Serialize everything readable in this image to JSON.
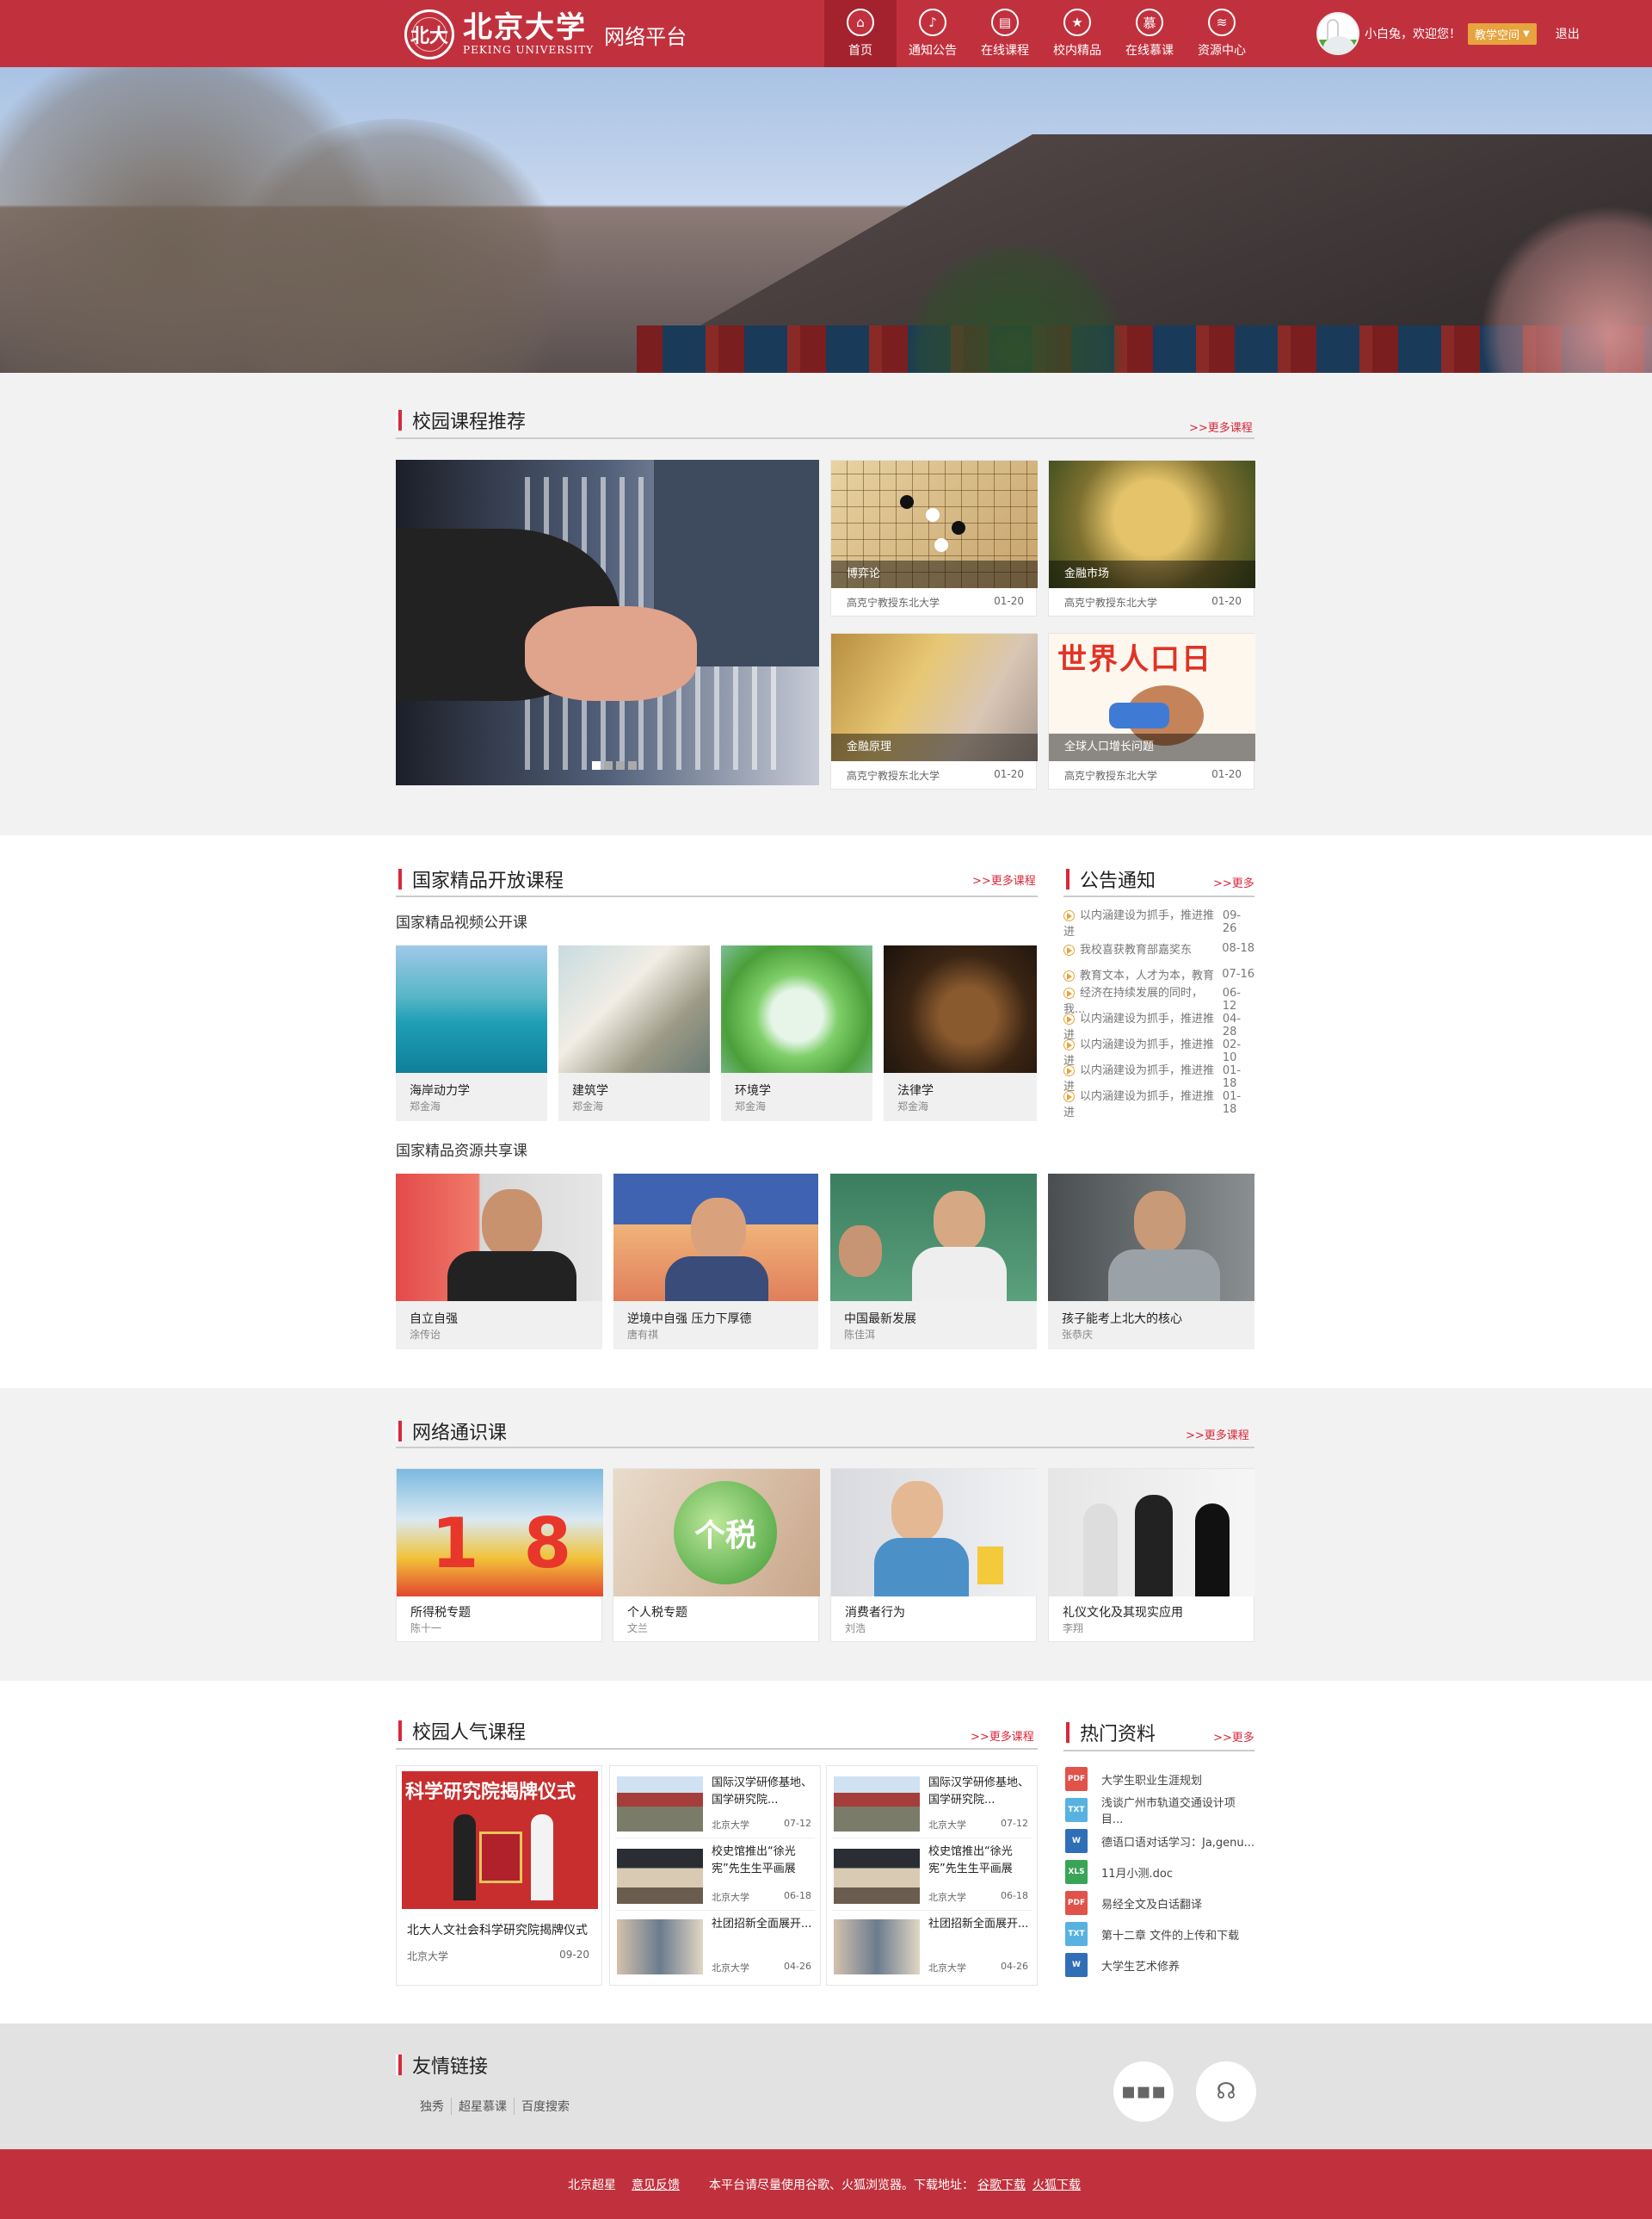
{
  "header": {
    "logo_seal": "北大",
    "logo_cn": "北京大学",
    "logo_en": "PEKING UNIVERSITY",
    "platform": "网络平台",
    "menu": [
      {
        "label": "首页",
        "icon": "home-icon",
        "glyph": "⌂"
      },
      {
        "label": "通知公告",
        "icon": "bell-icon",
        "glyph": "♪"
      },
      {
        "label": "在线课程",
        "icon": "book-icon",
        "glyph": "▤"
      },
      {
        "label": "校内精品",
        "icon": "star-icon",
        "glyph": "★"
      },
      {
        "label": "在线慕课",
        "icon": "mooc-icon",
        "glyph": "慕"
      },
      {
        "label": "资源中心",
        "icon": "layers-icon",
        "glyph": "≋"
      }
    ],
    "welcome": "小白兔，欢迎您！",
    "space_label": "教学空间",
    "logout": "退出"
  },
  "campus": {
    "title": "校园课程推荐",
    "more": ">>更多课程",
    "courses": [
      {
        "name": "博弈论",
        "teacher": "高克宁教授东北大学",
        "date": "01-20"
      },
      {
        "name": "金融市场",
        "teacher": "高克宁教授东北大学",
        "date": "01-20"
      },
      {
        "name": "金融原理",
        "teacher": "高克宁教授东北大学",
        "date": "01-20"
      },
      {
        "name": "全球人口增长问题",
        "teacher": "高克宁教授东北大学",
        "date": "01-20"
      }
    ],
    "poster_text": "世界人口日"
  },
  "national": {
    "title": "国家精品开放课程",
    "more": ">>更多课程",
    "video_title": "国家精品视频公开课",
    "videos": [
      {
        "name": "海岸动力学",
        "teacher": "郑金海"
      },
      {
        "name": "建筑学",
        "teacher": "郑金海"
      },
      {
        "name": "环境学",
        "teacher": "郑金海"
      },
      {
        "name": "法律学",
        "teacher": "郑金海"
      }
    ],
    "share_title": "国家精品资源共享课",
    "shares": [
      {
        "name": "自立自强",
        "teacher": "涂传诒"
      },
      {
        "name": "逆境中自强 压力下厚德",
        "teacher": "唐有祺"
      },
      {
        "name": "中国最新发展",
        "teacher": "陈佳洱"
      },
      {
        "name": "孩子能考上北大的核心",
        "teacher": "张恭庆"
      }
    ]
  },
  "notice": {
    "title": "公告通知",
    "more": ">>更多",
    "items": [
      {
        "text": "以内涵建设为抓手，推进推进",
        "date": "09-26"
      },
      {
        "text": "我校喜获教育部嘉奖东",
        "date": "08-18"
      },
      {
        "text": "教育文本，人才为本，教育",
        "date": "07-16"
      },
      {
        "text": "经济在持续发展的同时，我...",
        "date": "06-12"
      },
      {
        "text": "以内涵建设为抓手，推进推进",
        "date": "04-28"
      },
      {
        "text": "以内涵建设为抓手，推进推进",
        "date": "02-10"
      },
      {
        "text": "以内涵建设为抓手，推进推进",
        "date": "01-18"
      },
      {
        "text": "以内涵建设为抓手，推进推进",
        "date": "01-18"
      }
    ]
  },
  "general": {
    "title": "网络通识课",
    "more": ">>更多课程",
    "items": [
      {
        "name": "所得税专题",
        "teacher": "陈十一"
      },
      {
        "name": "个人税专题",
        "teacher": "文兰"
      },
      {
        "name": "消费者行为",
        "teacher": "刘浩"
      },
      {
        "name": "礼仪文化及其现实应用",
        "teacher": "李翔"
      }
    ],
    "tax_glyph": "个税",
    "big_numbers": "1 8"
  },
  "popular": {
    "title": "校园人气课程",
    "more": ">>更多课程",
    "feature": {
      "name": "北大人文社会科学研究院揭牌仪式",
      "source": "北京大学",
      "date": "09-20",
      "banner": "科学研究院揭牌仪式"
    },
    "col1": [
      {
        "name": "国际汉学研修基地、国学研究院...",
        "source": "北京大学",
        "date": "07-12"
      },
      {
        "name": "校史馆推出“徐光宪”先生生平画展",
        "source": "北京大学",
        "date": "06-18"
      },
      {
        "name": "社团招新全面展开...",
        "source": "北京大学",
        "date": "04-26"
      }
    ],
    "col2": [
      {
        "name": "国际汉学研修基地、国学研究院...",
        "source": "北京大学",
        "date": "07-12"
      },
      {
        "name": "校史馆推出“徐光宪”先生生平画展",
        "source": "北京大学",
        "date": "06-18"
      },
      {
        "name": "社团招新全面展开...",
        "source": "北京大学",
        "date": "04-26"
      }
    ]
  },
  "hot": {
    "title": "热门资料",
    "more": ">>更多",
    "files": [
      {
        "name": "大学生职业生涯规划",
        "type": "PDF",
        "color": "#e0524a"
      },
      {
        "name": "浅谈广州市轨道交通设计项目...",
        "type": "TXT",
        "color": "#58b2df"
      },
      {
        "name": "德语口语对话学习：Ja,genu...",
        "type": "W",
        "color": "#2f6fb7"
      },
      {
        "name": "11月小测.doc",
        "type": "XLS",
        "color": "#3aa457"
      },
      {
        "name": "易经全文及白话翻译",
        "type": "PDF",
        "color": "#e0524a"
      },
      {
        "name": "第十二章 文件的上传和下载",
        "type": "TXT",
        "color": "#58b2df"
      },
      {
        "name": "大学生艺术修养",
        "type": "W",
        "color": "#2f6fb7"
      }
    ]
  },
  "links": {
    "title": "友情链接",
    "items": [
      "独秀",
      "超星慕课",
      "百度搜索"
    ]
  },
  "footer": {
    "brand": "北京超星",
    "feedback": "意见反馈",
    "note": "本平台请尽量使用谷歌、火狐浏览器。下载地址：",
    "chrome": "谷歌下载",
    "firefox": "火狐下载"
  }
}
